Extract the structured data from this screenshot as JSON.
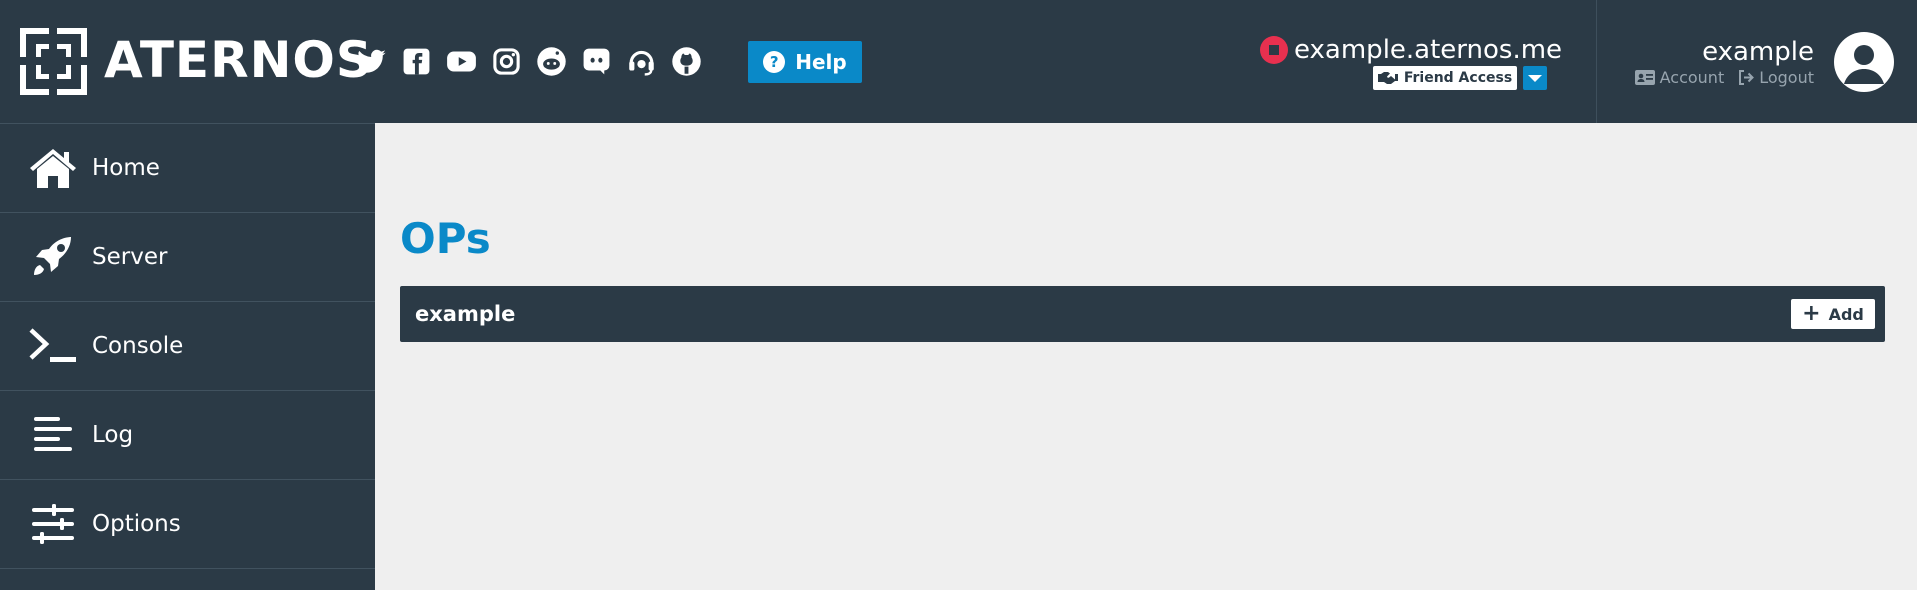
{
  "header": {
    "brand": "ATERNOS",
    "social_icons": [
      "twitter-icon",
      "facebook-icon",
      "youtube-icon",
      "instagram-icon",
      "reddit-icon",
      "discord-icon",
      "support-headset-icon",
      "github-icon"
    ],
    "help_label": "Help",
    "server": {
      "address": "example.aternos.me",
      "status_color": "#e8304f",
      "friend_access_label": "Friend Access"
    },
    "user": {
      "name": "example",
      "account_label": "Account",
      "logout_label": "Logout"
    }
  },
  "sidebar": {
    "items": [
      {
        "label": "Home",
        "icon": "home-icon"
      },
      {
        "label": "Server",
        "icon": "rocket-icon"
      },
      {
        "label": "Console",
        "icon": "terminal-icon"
      },
      {
        "label": "Log",
        "icon": "log-lines-icon"
      },
      {
        "label": "Options",
        "icon": "sliders-icon"
      }
    ]
  },
  "main": {
    "title": "OPs",
    "ops": [
      {
        "name": "example",
        "action_label": "Add"
      }
    ]
  },
  "colors": {
    "header_bg": "#2b3a46",
    "accent": "#0a89c8",
    "status_offline": "#e8304f",
    "content_bg": "#efefef"
  }
}
